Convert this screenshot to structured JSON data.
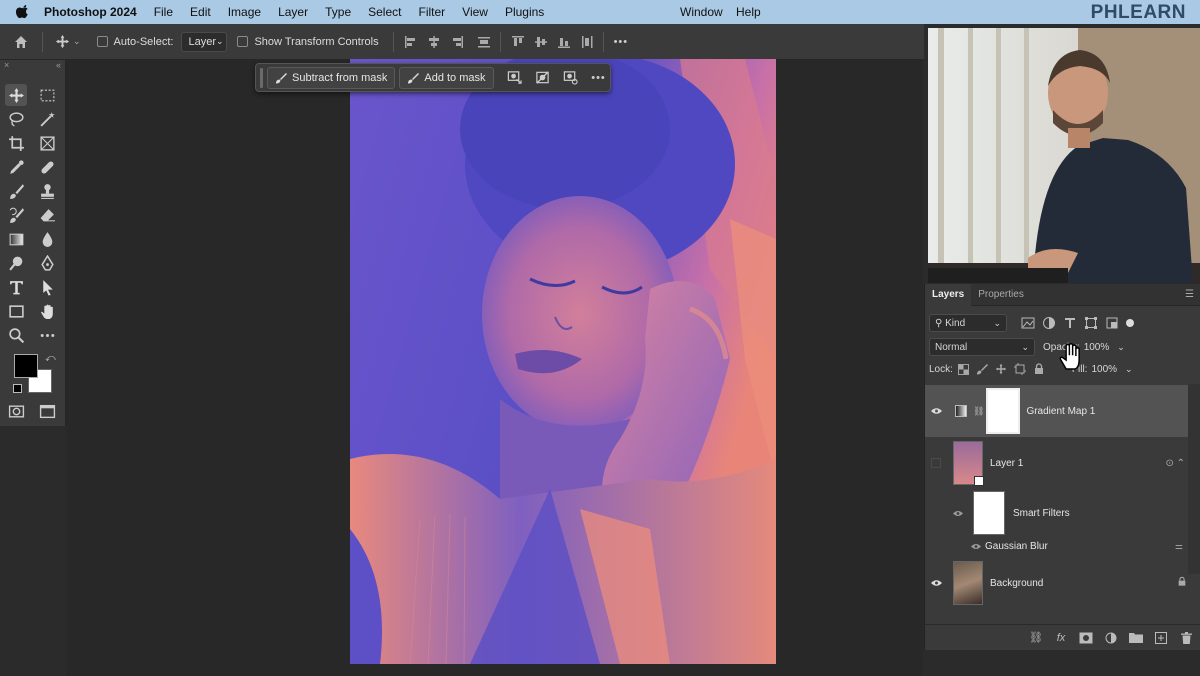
{
  "menubar": {
    "app": "Photoshop 2024",
    "items": [
      "File",
      "Edit",
      "Image",
      "Layer",
      "Type",
      "Select",
      "Filter",
      "View",
      "Plugins"
    ],
    "window": "Window",
    "help": "Help",
    "brand": "PHLEARN"
  },
  "options_bar": {
    "auto_select_label": "Auto-Select:",
    "auto_select_value": "Layer",
    "transform_label": "Show Transform Controls",
    "more": "•••"
  },
  "context_bar": {
    "subtract_label": "Subtract from mask",
    "add_label": "Add to mask",
    "more": "•••"
  },
  "layers_panel": {
    "tabs": [
      "Layers",
      "Properties"
    ],
    "filter_kind": "Kind",
    "blend_mode": "Normal",
    "opacity_label": "Opacity:",
    "opacity_value": "100%",
    "lock_label": "Lock:",
    "fill_label": "Fill:",
    "fill_value": "100%",
    "layers": [
      {
        "name": "Gradient Map 1",
        "visible": true,
        "selected": true
      },
      {
        "name": "Layer 1",
        "visible": false
      },
      {
        "name": "Smart Filters",
        "visible": true
      },
      {
        "name": "Gaussian Blur",
        "visible": true
      },
      {
        "name": "Background",
        "visible": true,
        "locked": true
      }
    ],
    "footer_fx": "fx"
  },
  "colors": {
    "accent": "#a9c9e4",
    "panel": "#3a3a3a",
    "photo_blue": "#5a50c8",
    "photo_orange": "#e87a78"
  }
}
